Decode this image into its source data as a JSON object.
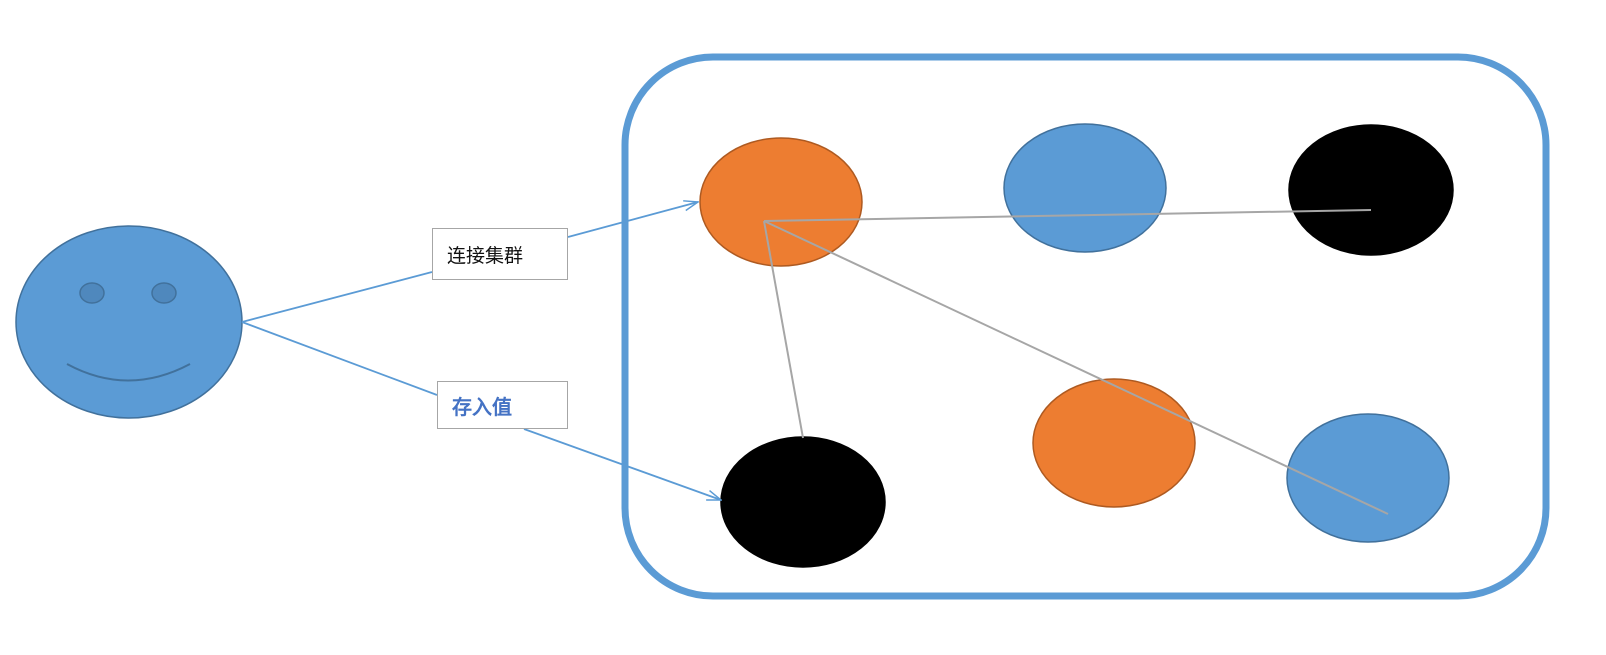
{
  "labels": {
    "connect_cluster": "连接集群",
    "store_value": "存入值"
  },
  "colors": {
    "blue_fill": "#5b9bd5",
    "blue_stroke": "#41719c",
    "orange_fill": "#ed7d31",
    "orange_stroke": "#ae5a21",
    "black_fill": "#000000",
    "connector_gray": "#a6a6a6",
    "arrow_blue": "#5b9bd5",
    "frame_blue": "#5b9bd5"
  },
  "icons": {
    "client": "smiley-face-icon"
  },
  "nodes": [
    {
      "id": "node-orange-1",
      "color": "orange"
    },
    {
      "id": "node-blue-1",
      "color": "blue"
    },
    {
      "id": "node-black-1",
      "color": "black"
    },
    {
      "id": "node-black-2",
      "color": "black"
    },
    {
      "id": "node-orange-2",
      "color": "orange"
    },
    {
      "id": "node-blue-2",
      "color": "blue"
    }
  ]
}
